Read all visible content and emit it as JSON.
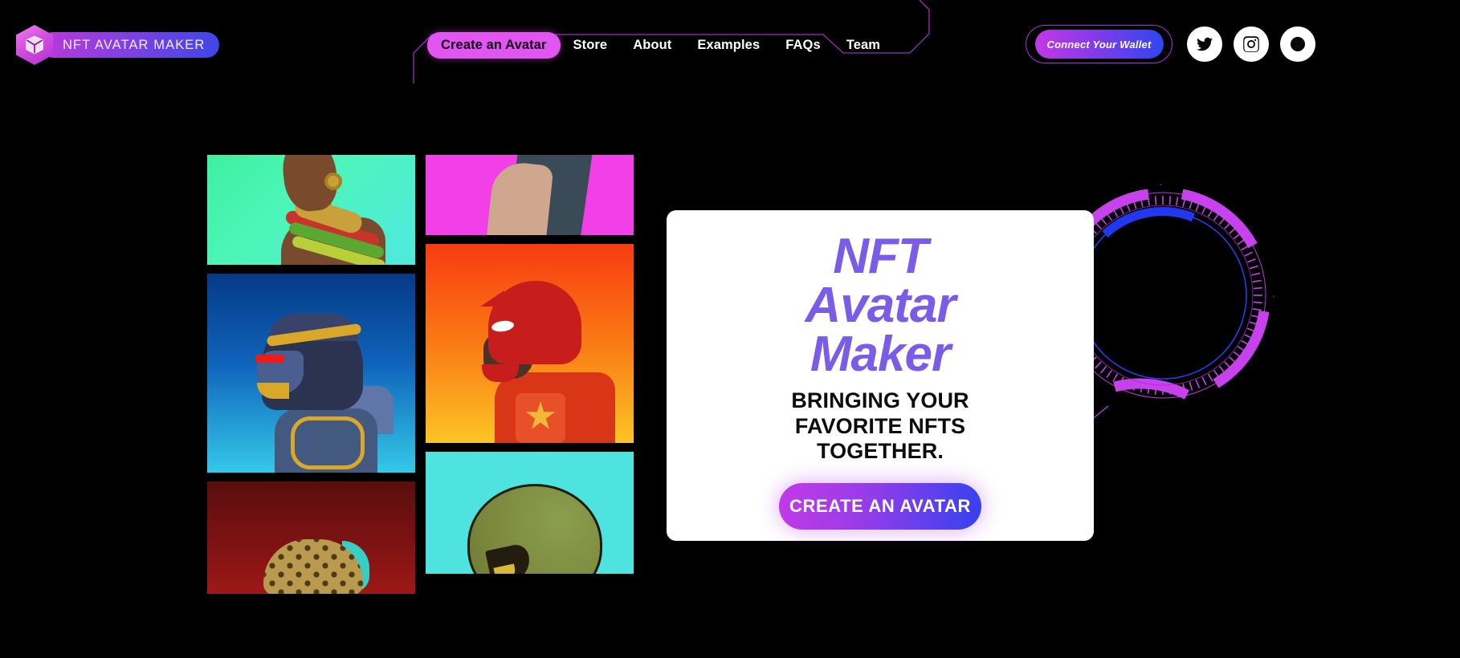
{
  "site": {
    "background_color": "#000000",
    "accent_magenta": "#e155f0",
    "accent_purple": "#7b5ce8",
    "accent_blue": "#3342ef"
  },
  "header": {
    "logo": {
      "text": "NFT AVATAR MAKER",
      "icon": "cube-box-icon",
      "hex_color": "#d44fe0"
    },
    "nav": [
      {
        "label": "Create an Avatar",
        "active": true
      },
      {
        "label": "Store",
        "active": false
      },
      {
        "label": "About",
        "active": false
      },
      {
        "label": "Examples",
        "active": false
      },
      {
        "label": "FAQs",
        "active": false
      },
      {
        "label": "Team",
        "active": false
      }
    ],
    "wallet_button": {
      "label": "Connect Your Wallet"
    },
    "socials": [
      {
        "name": "twitter-icon"
      },
      {
        "name": "instagram-icon"
      },
      {
        "name": "social-icon-third"
      }
    ]
  },
  "hero": {
    "title_lines": [
      "NFT",
      "Avatar",
      "Maker"
    ],
    "subtitle": "BRINGING YOUR FAVORITE NFTS TOGETHER.",
    "cta_label": "CREATE AN AVATAR"
  },
  "gallery": {
    "columns": [
      {
        "tiles": [
          {
            "id": "tribal-profile",
            "bg": "green-cyan-gradient"
          },
          {
            "id": "hooded-ninja",
            "bg": "blue-cyan-gradient"
          },
          {
            "id": "leopard-headwrap",
            "bg": "dark-red-gradient"
          }
        ]
      },
      {
        "tiles": [
          {
            "id": "pink-figure",
            "bg": "magenta"
          },
          {
            "id": "red-helmet-hero",
            "bg": "orange-yellow-gradient"
          },
          {
            "id": "alien-head",
            "bg": "cyan"
          }
        ]
      }
    ]
  },
  "decor": {
    "hud_ring": "sci-fi-hud-ring",
    "nav_frame": "angular-purple-frame"
  }
}
